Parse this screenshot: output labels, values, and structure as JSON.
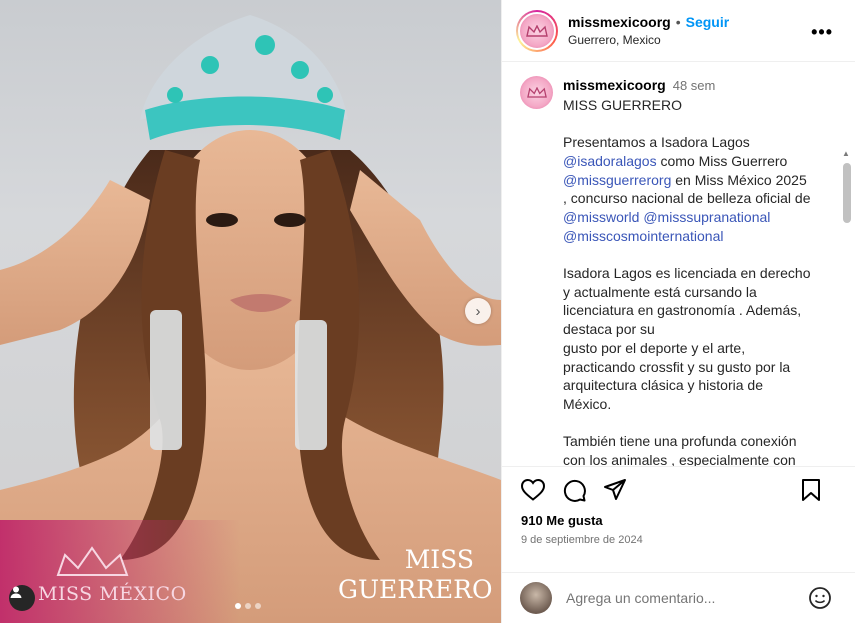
{
  "post": {
    "username": "missmexicoorg",
    "separator": "•",
    "follow_label": "Seguir",
    "location": "Guerrero, Mexico",
    "more_label": "•••"
  },
  "photo": {
    "logo_text": "MISS MÉXICO",
    "title_line1": "MISS",
    "title_line2": "GUERRERO",
    "next_icon": "chevron-right-icon",
    "tag_icon": "user-icon",
    "dots": [
      true,
      false,
      false
    ]
  },
  "caption": {
    "username": "missmexicoorg",
    "time": "48 sem",
    "title": "MISS GUERRERO",
    "p1_a": "Presentamos a  Isadora Lagos",
    "m_isadora": "@isadoralagos",
    "p1_b": " como Miss Guerrero",
    "m_guerrero": "@missguerrerorg",
    "p1_c": "  en Miss México 2025",
    "p1_d": ", concurso nacional de belleza oficial de",
    "m_world": "@missworld",
    "m_supra": "@misssupranational",
    "m_cosmo": "@misscosmointernational",
    "p2_1": "Isadora Lagos es licenciada en derecho",
    "p2_2": "y actualmente está cursando la",
    "p2_3": "licenciatura en gastronomía . Además,",
    "p2_4": "destaca por su",
    "p2_5": "gusto por el deporte y el arte,",
    "p2_6": "practicando crossfit  y su gusto por la",
    "p2_7": "arquitectura clásica y historia de",
    "p2_8": "México.",
    "p3_1": "También tiene una profunda conexión",
    "p3_2": "con los animales , especialmente con"
  },
  "actions": {
    "icons": [
      "heart-icon",
      "comment-icon",
      "share-icon",
      "bookmark-icon"
    ],
    "likes": "910 Me gusta",
    "date": "9 de septiembre de 2024"
  },
  "comment": {
    "placeholder": "Agrega un comentario...",
    "emoji_icon": "smiley-icon"
  },
  "colors": {
    "link": "#0095f6",
    "mention": "#3a56b8",
    "muted": "#737373"
  }
}
